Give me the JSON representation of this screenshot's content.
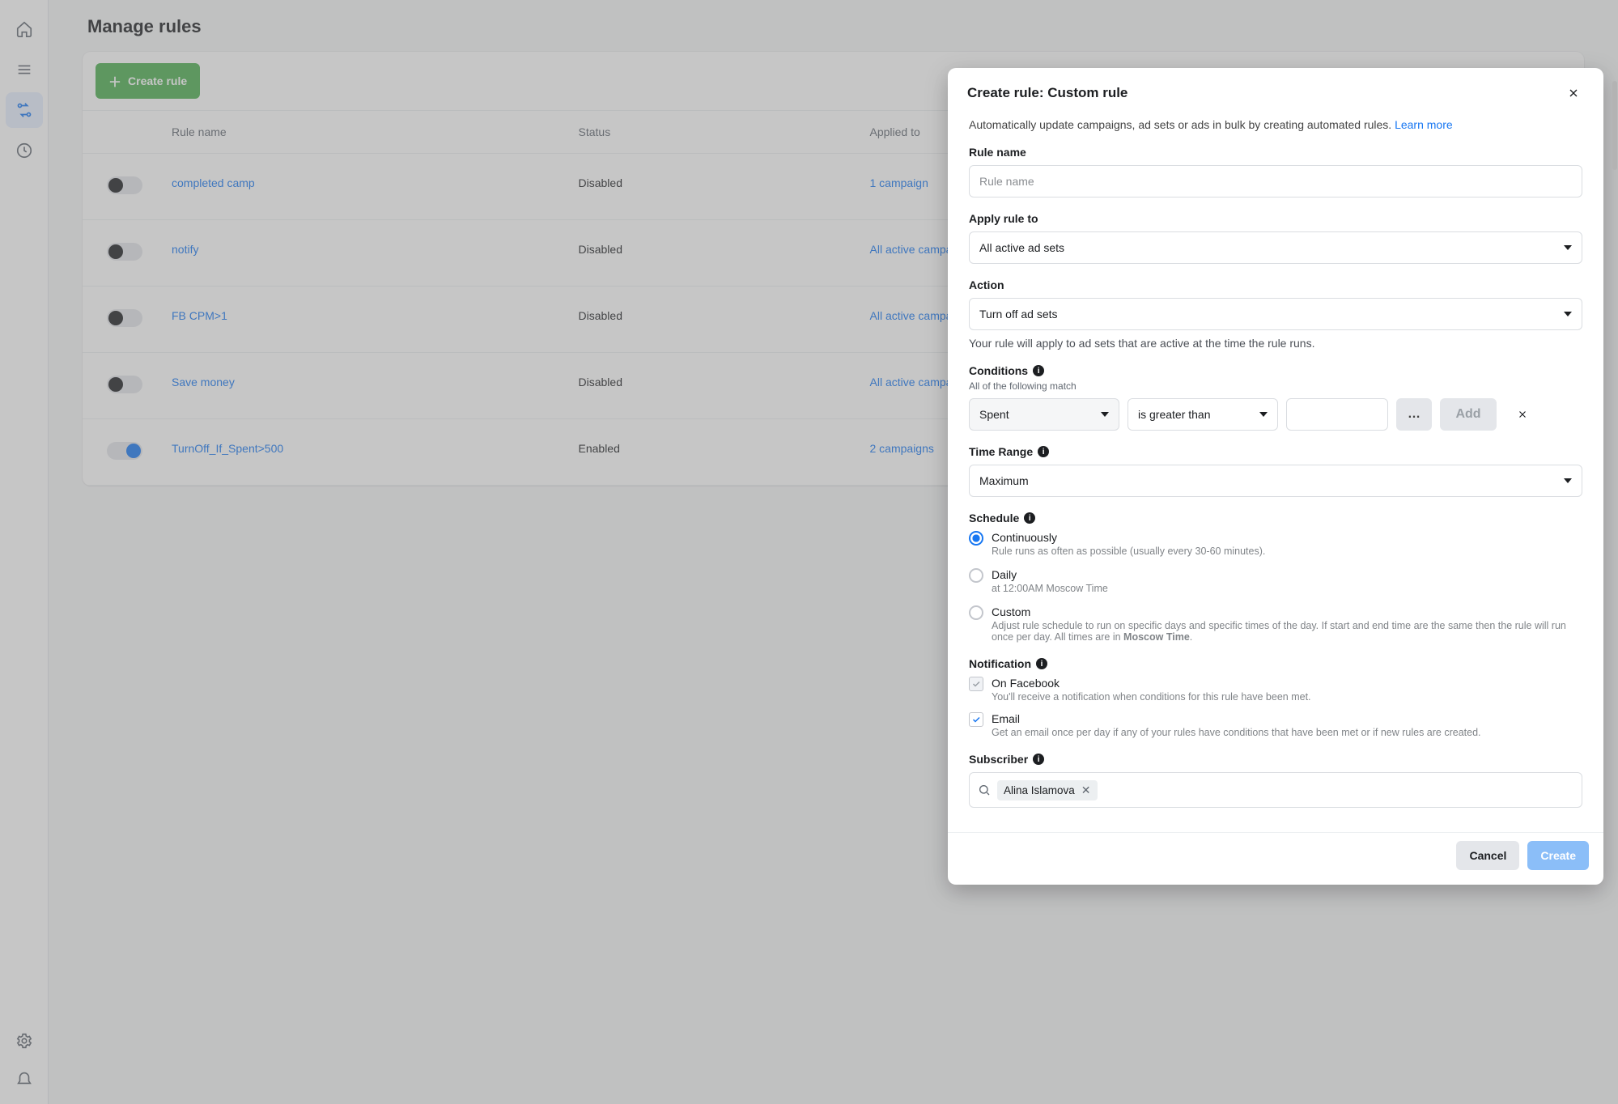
{
  "page": {
    "title": "Manage rules"
  },
  "toolbar": {
    "create_rule": "Create rule"
  },
  "columns": {
    "toggle": "",
    "name": "Rule name",
    "status": "Status",
    "applied": "Applied to"
  },
  "rules": [
    {
      "enabled": false,
      "name": "completed camp",
      "status": "Disabled",
      "applied": "1 campaign"
    },
    {
      "enabled": false,
      "name": "notify",
      "status": "Disabled",
      "applied": "All active campaigns"
    },
    {
      "enabled": false,
      "name": "FB CPM>1",
      "status": "Disabled",
      "applied": "All active campaigns"
    },
    {
      "enabled": false,
      "name": "Save money",
      "status": "Disabled",
      "applied": "All active campaigns"
    },
    {
      "enabled": true,
      "name": "TurnOff_If_Spent>500",
      "status": "Enabled",
      "applied": "2 campaigns"
    }
  ],
  "modal": {
    "title": "Create rule: Custom rule",
    "desc": "Automatically update campaigns, ad sets or ads in bulk by creating automated rules. ",
    "learn_more": "Learn more",
    "labels": {
      "rule_name": "Rule name",
      "apply_to": "Apply rule to",
      "action": "Action",
      "conditions": "Conditions",
      "conditions_sub": "All of the following match",
      "time_range": "Time Range",
      "schedule": "Schedule",
      "notification": "Notification",
      "subscriber": "Subscriber"
    },
    "placeholders": {
      "rule_name": "Rule name"
    },
    "values": {
      "apply_to": "All active ad sets",
      "action": "Turn off ad sets",
      "time_range": "Maximum"
    },
    "apply_note": "Your rule will apply to ad sets that are active at the time the rule runs.",
    "condition": {
      "metric": "Spent",
      "op": "is greater than",
      "value": "",
      "add": "Add"
    },
    "schedule_options": {
      "continuously": {
        "title": "Continuously",
        "desc": "Rule runs as often as possible (usually every 30-60 minutes)."
      },
      "daily": {
        "title": "Daily",
        "desc": "at 12:00AM Moscow Time"
      },
      "custom": {
        "title": "Custom",
        "desc_pre": "Adjust rule schedule to run on specific days and specific times of the day. If start and end time are the same then the rule will run once per day. All times are in ",
        "tz": "Moscow Time",
        "desc_post": "."
      }
    },
    "notifications": {
      "facebook": {
        "title": "On Facebook",
        "desc": "You'll receive a notification when conditions for this rule have been met."
      },
      "email": {
        "title": "Email",
        "desc": "Get an email once per day if any of your rules have conditions that have been met or if new rules are created."
      }
    },
    "subscriber": {
      "chip": "Alina Islamova"
    },
    "buttons": {
      "cancel": "Cancel",
      "create": "Create"
    }
  }
}
